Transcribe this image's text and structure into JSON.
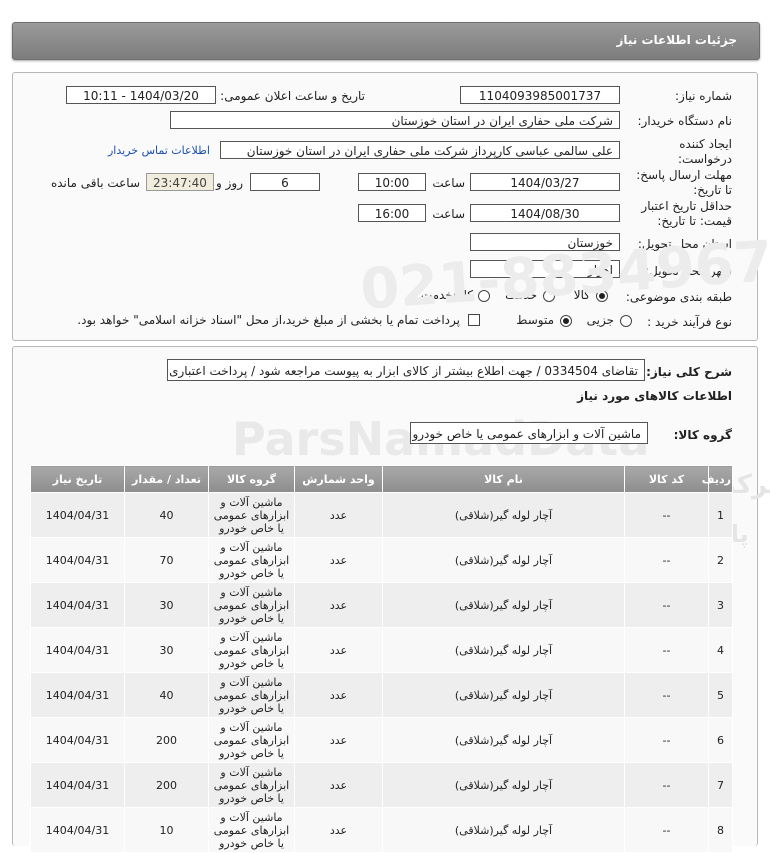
{
  "header": {
    "title": "جزئیات اطلاعات نیاز"
  },
  "form": {
    "need_number_label": "شماره نیاز:",
    "need_number": "1104093985001737",
    "announce_label": "تاریخ و ساعت اعلان عمومی:",
    "announce_value": "1404/03/20 - 10:11",
    "buyer_org_label": "نام دستگاه خریدار:",
    "buyer_org": "شرکت ملی حفاری ایران در استان خوزستان",
    "creator_label_1": "ایجاد کننده",
    "creator_label_2": "درخواست:",
    "creator": "علی سالمی عباسی کارپرداز شرکت ملی حفاری ایران در استان خوزستان",
    "contact_link": "اطلاعات تماس خریدار",
    "reply_deadline_label_1": "مهلت ارسال پاسخ:",
    "reply_deadline_label_2": "تا تاریخ:",
    "reply_date": "1404/03/27",
    "time_label": "ساعت",
    "reply_time": "10:00",
    "days_value": "6",
    "days_label": "روز و",
    "remaining_time": "23:47:40",
    "remaining_label": "ساعت باقی مانده",
    "validity_label_1": "حداقل تاریخ اعتبار",
    "validity_label_2": "قیمت: تا تاریخ:",
    "validity_date": "1404/08/30",
    "validity_time": "16:00",
    "province_label": "استان محل تحویل:",
    "province": "خوزستان",
    "city_label": "شهر محل تحویل:",
    "city": "اهواز",
    "category_label": "طبقه بندی موضوعی:",
    "category_options": [
      "کالا",
      "خدمت",
      "کالا/خدمت"
    ],
    "category_selected": "کالا",
    "process_label": "نوع فرآیند خرید :",
    "process_options": [
      "جزیی",
      "متوسط"
    ],
    "process_selected": "متوسط",
    "payment_note": "پرداخت تمام یا بخشی از مبلغ خرید،از محل \"اسناد خزانه اسلامی\" خواهد بود."
  },
  "details": {
    "desc_label": "شرح کلی نیاز:",
    "description": "تقاضای 0334504 / جهت اطلاع بیشتر از کالای ابزار به پیوست مراجعه شود / پرداخت اعتباری",
    "goods_info_title": "اطلاعات کالاهای مورد نیاز",
    "goods_group_label": "گروه کالا:",
    "goods_group": "ماشین آلات و ابزارهای عمومی یا خاص خودرو"
  },
  "table": {
    "headers": [
      "ردیف",
      "کد کالا",
      "نام کالا",
      "واحد شمارش",
      "گروه کالا",
      "تعداد / مقدار",
      "تاریخ نیاز"
    ],
    "rows": [
      {
        "row": "1",
        "code": "--",
        "name": "آچار لوله گیر(شلاقی)",
        "unit": "عدد",
        "group": "ماشین آلات و ابزارهای عمومی یا خاص خودرو",
        "qty": "40",
        "date": "1404/04/31"
      },
      {
        "row": "2",
        "code": "--",
        "name": "آچار لوله گیر(شلاقی)",
        "unit": "عدد",
        "group": "ماشین آلات و ابزارهای عمومی یا خاص خودرو",
        "qty": "70",
        "date": "1404/04/31"
      },
      {
        "row": "3",
        "code": "--",
        "name": "آچار لوله گیر(شلاقی)",
        "unit": "عدد",
        "group": "ماشین آلات و ابزارهای عمومی یا خاص خودرو",
        "qty": "30",
        "date": "1404/04/31"
      },
      {
        "row": "4",
        "code": "--",
        "name": "آچار لوله گیر(شلاقی)",
        "unit": "عدد",
        "group": "ماشین آلات و ابزارهای عمومی یا خاص خودرو",
        "qty": "30",
        "date": "1404/04/31"
      },
      {
        "row": "5",
        "code": "--",
        "name": "آچار لوله گیر(شلاقی)",
        "unit": "عدد",
        "group": "ماشین آلات و ابزارهای عمومی یا خاص خودرو",
        "qty": "40",
        "date": "1404/04/31"
      },
      {
        "row": "6",
        "code": "--",
        "name": "آچار لوله گیر(شلاقی)",
        "unit": "عدد",
        "group": "ماشین آلات و ابزارهای عمومی یا خاص خودرو",
        "qty": "200",
        "date": "1404/04/31"
      },
      {
        "row": "7",
        "code": "--",
        "name": "آچار لوله گیر(شلاقی)",
        "unit": "عدد",
        "group": "ماشین آلات و ابزارهای عمومی یا خاص خودرو",
        "qty": "200",
        "date": "1404/04/31"
      },
      {
        "row": "8",
        "code": "--",
        "name": "آچار لوله گیر(شلاقی)",
        "unit": "عدد",
        "group": "ماشین آلات و ابزارهای عمومی یا خاص خودرو",
        "qty": "10",
        "date": "1404/04/31"
      }
    ]
  },
  "watermark": {
    "number": "021-88349670-5",
    "site": "ParsNamadData",
    "line1": "مرکز فراوری اطلاعات پارس نماد داده",
    "line2": "پایگاه اطلاع رسانی مناقصه و مزایده",
    "phone": "۰۲۱-۸۸۳۴۹۶۷۰-۵"
  }
}
